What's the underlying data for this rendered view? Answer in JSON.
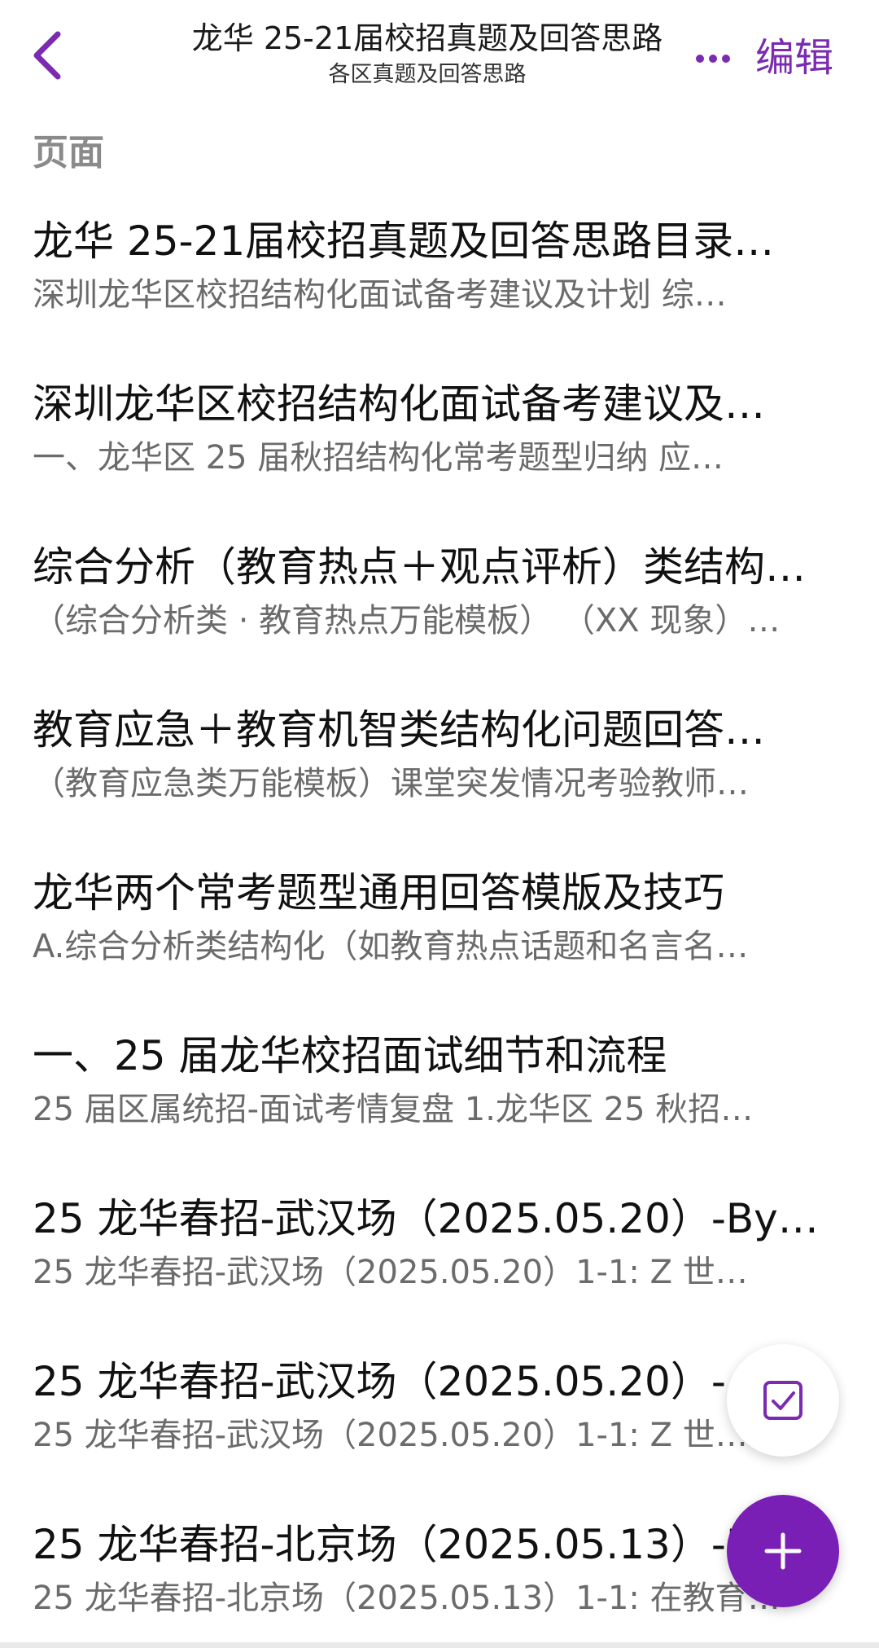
{
  "header": {
    "title": "龙华 25-21届校招真题及回答思路",
    "subtitle": "各区真题及回答思路",
    "edit_label": "编辑",
    "back_icon": "chevron-left-icon",
    "more_icon": "more-horizontal-icon"
  },
  "section": {
    "label": "页面"
  },
  "pages": [
    {
      "title": "龙华 25-21届校招真题及回答思路目录…",
      "preview": "深圳龙华区校招结构化面试备考建议及计划  综…"
    },
    {
      "title": "深圳龙华区校招结构化面试备考建议及…",
      "preview": "一、龙华区 25 届秋招结构化常考题型归纳  应…"
    },
    {
      "title": "综合分析（教育热点＋观点评析）类结构…",
      "preview": "（综合分析类 · 教育热点万能模板）  （XX 现象）…"
    },
    {
      "title": "教育应急＋教育机智类结构化问题回答…",
      "preview": "（教育应急类万能模板）课堂突发情况考验教师…"
    },
    {
      "title": "龙华两个常考题型通用回答模版及技巧",
      "preview": "A.综合分析类结构化（如教育热点话题和名言名…"
    },
    {
      "title": "一、25 届龙华校招面试细节和流程",
      "preview": "25 届区属统招-面试考情复盘  1.龙华区 25 秋招…"
    },
    {
      "title": "25 龙华春招-武汉场（2025.05.20）-By…",
      "preview": "25 龙华春招-武汉场（2025.05.20）1-1:    Z 世…"
    },
    {
      "title": "25 龙华春招-武汉场（2025.05.20）-…",
      "preview": "25 龙华春招-武汉场（2025.05.20）1-1:    Z 世…"
    },
    {
      "title": "25 龙华春招-北京场（2025.05.13）-B…",
      "preview": "25 龙华春招-北京场（2025.05.13）1-1:  在教育…"
    }
  ],
  "fabs": {
    "task_icon": "checkbox-icon",
    "add_icon": "plus-icon"
  },
  "colors": {
    "accent": "#7a2bb0",
    "fab": "#7a1fb5",
    "title_text": "#111111",
    "preview_text": "#6b6b6b",
    "section_text": "#8a8a8a"
  }
}
